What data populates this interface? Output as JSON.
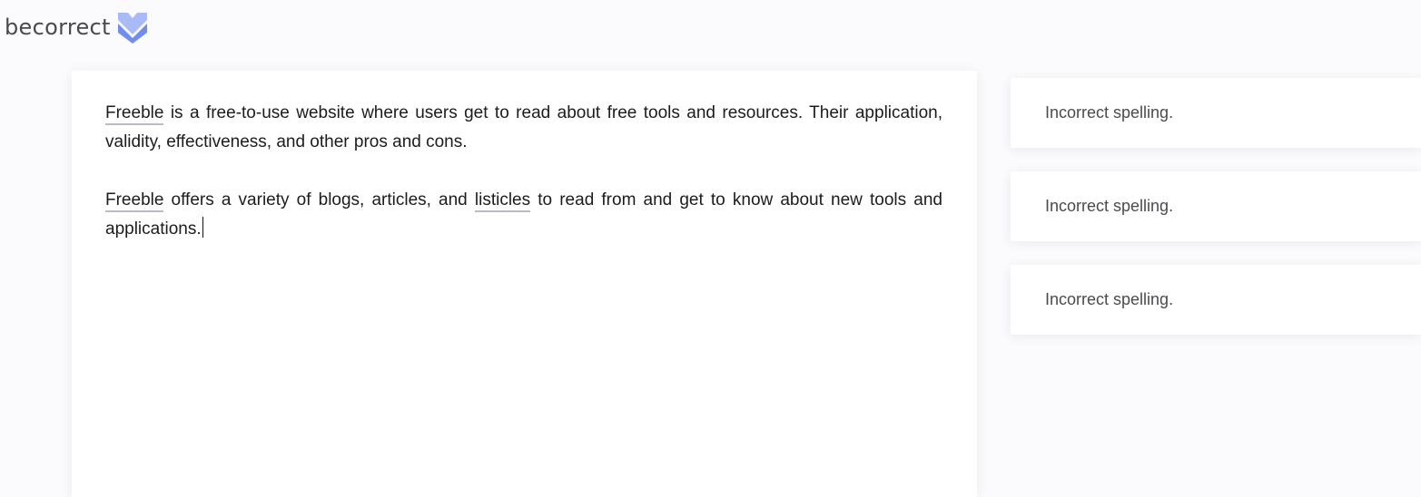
{
  "app": {
    "logo_text": "becorrect",
    "logo_icon": "chevron-mark-icon",
    "brand_color": "#6f8ef0"
  },
  "editor": {
    "paragraphs": [
      {
        "parts": [
          {
            "text": "Freeble",
            "misspelled": true
          },
          {
            "text": " is a free-to-use website where users get to read about free tools and resources. Their application, validity, effectiveness, and other pros and cons.",
            "misspelled": false
          }
        ]
      },
      {
        "parts": [
          {
            "text": "Freeble",
            "misspelled": true
          },
          {
            "text": " offers a variety of blogs, articles, and ",
            "misspelled": false
          },
          {
            "text": "listicles",
            "misspelled": true
          },
          {
            "text": " to read from and get to know about new tools and applications.",
            "misspelled": false
          }
        ]
      }
    ]
  },
  "suggestions": [
    {
      "message": "Incorrect spelling."
    },
    {
      "message": "Incorrect spelling."
    },
    {
      "message": "Incorrect spelling."
    }
  ]
}
